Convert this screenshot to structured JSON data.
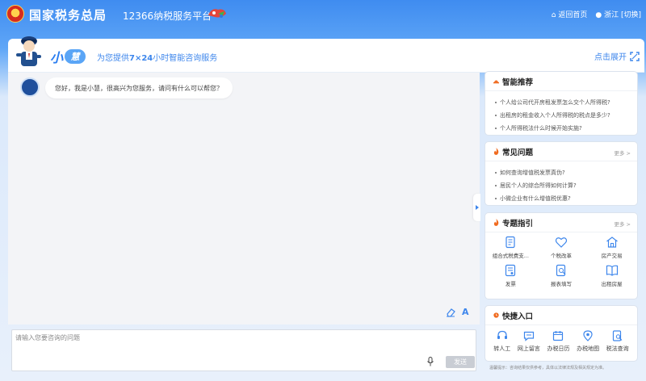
{
  "topbar": {
    "brand": "国家税务总局",
    "subbrand": "12366纳税服务平台",
    "home_link": "返回首页",
    "location": "浙江",
    "switch": "[切换]"
  },
  "header": {
    "assistant_name_prefix": "小",
    "assistant_name_badge": "慧",
    "tagline_pre": "为您提供",
    "tagline_bold": "7×24",
    "tagline_post": "小时智能咨询服务",
    "expand_label": "点击展开"
  },
  "chat": {
    "greeting": "您好，我是小慧，很高兴为您服务，请问有什么可以帮您？",
    "input_placeholder": "请输入您要咨询的问题",
    "send_label": "发送",
    "font_tool": "A"
  },
  "smart_recommend": {
    "title": "智能推荐",
    "items": [
      "个人给公司代开房租发票怎么交个人所得税?",
      "出租房的租金收入个人所得税的税点是多少?",
      "个人所得税法什么时候开始实施?"
    ]
  },
  "faq": {
    "title": "常见问题",
    "more": "更多 >",
    "items": [
      "如何查询增值税发票真伪?",
      "居民个人的综合所得如何计算?",
      "小微企业有什么增值税优惠?"
    ]
  },
  "topics": {
    "title": "专题指引",
    "more": "更多 >",
    "items": [
      {
        "label": "组合式税费支...",
        "icon": "document-icon"
      },
      {
        "label": "个税改革",
        "icon": "heart-icon"
      },
      {
        "label": "房产交易",
        "icon": "house-icon"
      },
      {
        "label": "发票",
        "icon": "invoice-icon"
      },
      {
        "label": "报表填写",
        "icon": "form-icon"
      },
      {
        "label": "出租房屋",
        "icon": "book-icon"
      }
    ]
  },
  "quick_entry": {
    "title": "快捷入口",
    "items": [
      {
        "label": "转人工",
        "icon": "headset-icon"
      },
      {
        "label": "网上留言",
        "icon": "message-icon"
      },
      {
        "label": "办税日历",
        "icon": "calendar-icon"
      },
      {
        "label": "办税地图",
        "icon": "map-pin-icon"
      },
      {
        "label": "税法查询",
        "icon": "search-doc-icon"
      }
    ]
  },
  "footnote": "温馨提示：咨询结果仅供参考，具体以法律法规及相关规定为准。",
  "colors": {
    "accent": "#3d86ec",
    "header_blue": "#3f8cf0",
    "fire": "#f06a1e"
  }
}
